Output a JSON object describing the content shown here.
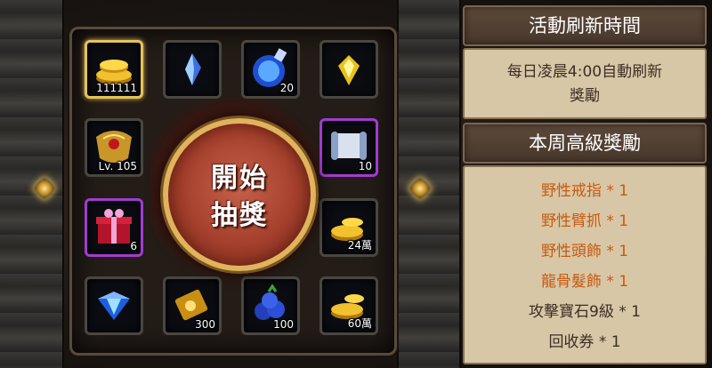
{
  "colors": {
    "reward_orange": "#c75a10",
    "reward_dark": "#3b2e25",
    "gold_border": "#e6c35b",
    "purple_border": "#a23bd1"
  },
  "board": {
    "start_button": {
      "line1": "開始",
      "line2": "抽獎"
    },
    "slots": [
      {
        "icon": "gold-coin-stack-icon",
        "qty": "111111",
        "border": "gold"
      },
      {
        "icon": "blue-crystal-icon",
        "qty": "",
        "border": "gray"
      },
      {
        "icon": "blue-potion-orb-icon",
        "qty": "20",
        "border": "gray"
      },
      {
        "icon": "yellow-gem-icon",
        "qty": "",
        "border": "gray"
      },
      {
        "icon": "ornate-gold-armor-icon",
        "qty": "Lv. 105",
        "border": "gray"
      },
      {
        "icon": "scroll-icon",
        "qty": "10",
        "border": "purple"
      },
      {
        "icon": "gift-box-icon",
        "qty": "6",
        "border": "purple"
      },
      {
        "icon": "gold-coin-stack-icon",
        "qty": "24萬",
        "border": "gray"
      },
      {
        "icon": "blue-diamond-icon",
        "qty": "",
        "border": "gray"
      },
      {
        "icon": "gold-ticket-icon",
        "qty": "300",
        "border": "gray"
      },
      {
        "icon": "blueberry-icon",
        "qty": "100",
        "border": "gray"
      },
      {
        "icon": "gold-coin-stack-icon",
        "qty": "60萬",
        "border": "gray"
      }
    ]
  },
  "refresh": {
    "title": "活動刷新時間",
    "line1": "每日凌晨4:00自動刷新",
    "line2": "獎勵"
  },
  "weekly": {
    "title": "本周高級獎勵",
    "rewards": [
      {
        "text": "野性戒指 * 1",
        "color": "orange"
      },
      {
        "text": "野性臂抓 * 1",
        "color": "orange"
      },
      {
        "text": "野性頭飾 * 1",
        "color": "orange"
      },
      {
        "text": "龍骨髮飾 * 1",
        "color": "orange"
      },
      {
        "text": "攻擊寶石9級 * 1",
        "color": "dark"
      },
      {
        "text": "回收券 * 1",
        "color": "dark"
      }
    ]
  }
}
